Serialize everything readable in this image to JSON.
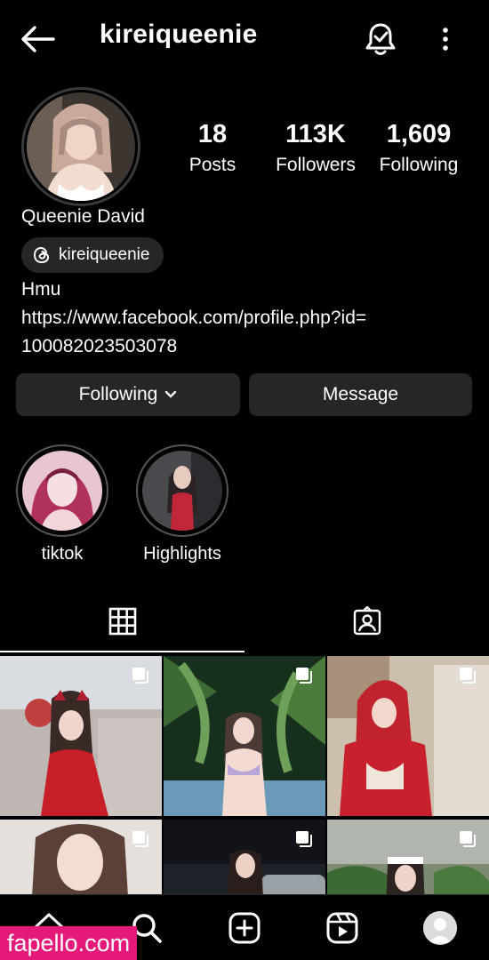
{
  "header": {
    "username": "kireiqueenie",
    "back_icon": "arrow-left-icon",
    "bell_icon": "bell-check-icon",
    "more_icon": "more-vertical-icon"
  },
  "profile": {
    "stats": {
      "posts_value": "18",
      "posts_label": "Posts",
      "followers_value": "113K",
      "followers_label": "Followers",
      "following_value": "1,609",
      "following_label": "Following"
    },
    "full_name": "Queenie David",
    "threads_handle": "kireiqueenie",
    "bio_line1": "Hmu",
    "bio_link": "https://www.facebook.com/profile.php?id=100082023503078",
    "bio_link_line1": "https://www.facebook.com/profile.php?id=",
    "bio_link_line2": "100082023503078"
  },
  "actions": {
    "following_label": "Following",
    "message_label": "Message"
  },
  "highlights": [
    {
      "label": "tiktok"
    },
    {
      "label": "Highlights"
    }
  ],
  "tabs": [
    {
      "icon": "grid-icon",
      "active": true
    },
    {
      "icon": "tagged-icon",
      "active": false
    }
  ],
  "bottom_nav": [
    "home-icon",
    "search-icon",
    "add-post-icon",
    "reels-icon",
    "profile-avatar"
  ],
  "watermark": "fapello.com",
  "colors": {
    "background": "#000000",
    "button_bg": "#262626",
    "watermark_bg": "#e5197a"
  }
}
